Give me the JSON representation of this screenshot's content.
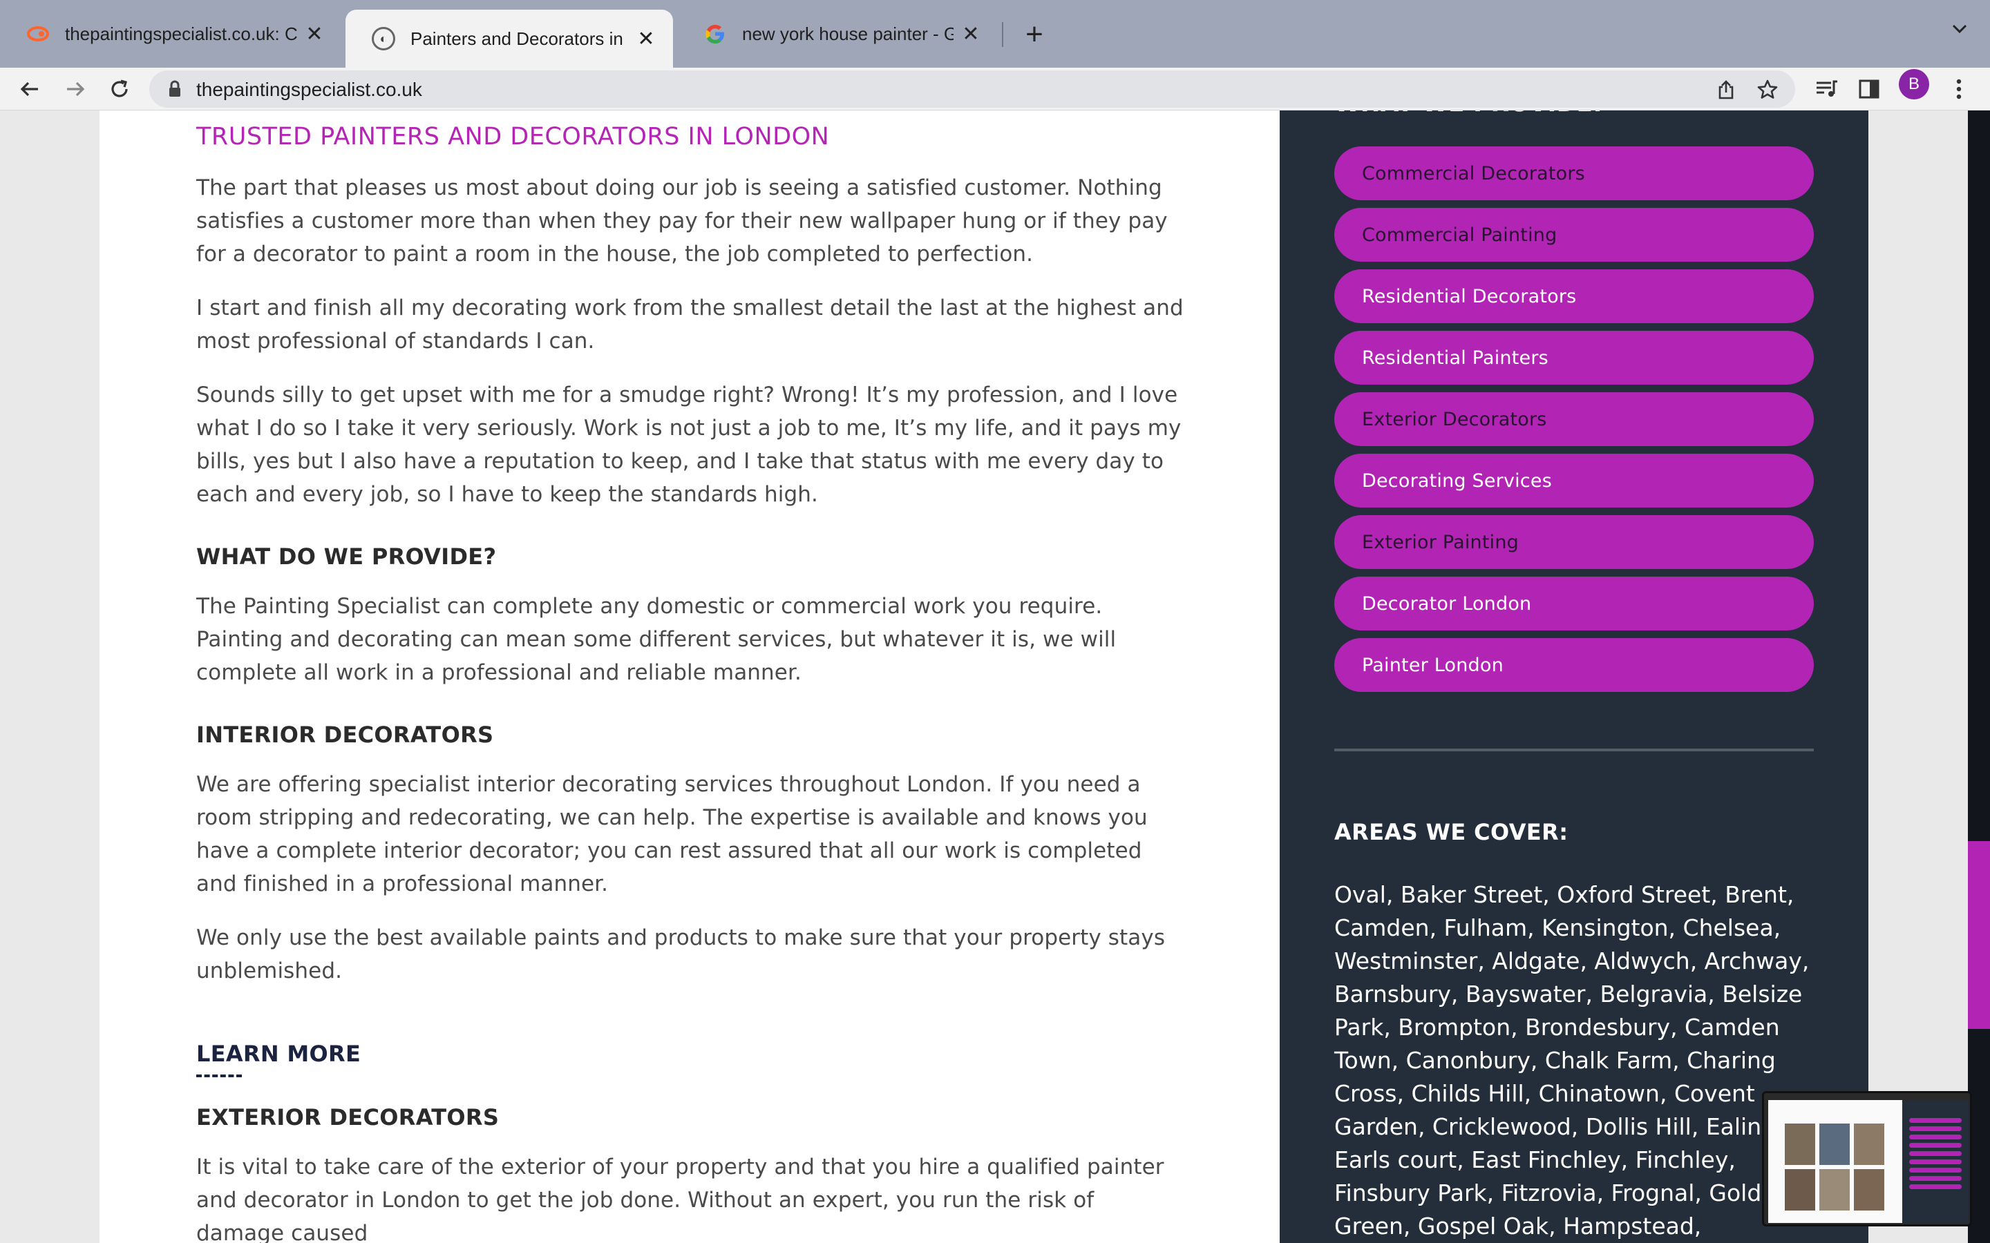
{
  "browser": {
    "tabs": [
      {
        "title": "thepaintingspecialist.co.uk: Co",
        "favicon": "semrush-icon",
        "active": false
      },
      {
        "title": "Painters and Decorators in Lon",
        "favicon": "site-icon",
        "active": true
      },
      {
        "title": "new york house painter - Goog",
        "favicon": "google-icon",
        "active": false
      }
    ],
    "new_tab_label": "+",
    "url": "thepaintingspecialist.co.uk",
    "profile_initial": "B"
  },
  "article": {
    "heading": "TRUSTED PAINTERS AND DECORATORS IN LONDON",
    "para1": "The part that pleases us most about doing our job is seeing a satisfied customer. Nothing satisfies a customer more than when they pay for their new wallpaper hung or if they pay for a decorator to paint a room in the house, the job completed to perfection.",
    "para2": "I start and finish all my decorating work from the smallest detail the last at the highest and most professional of standards I can.",
    "para3": "Sounds silly to get upset with me for a smudge right? Wrong! It’s my profession, and I love what I do so I take it very seriously. Work is not just a job to me, It’s my life, and it pays my bills, yes but I also have a reputation to keep, and I take that status with me every day to each and every job, so I have to keep the standards high.",
    "provide_heading": "WHAT DO WE PROVIDE?",
    "provide_para": "The Painting Specialist can complete any domestic or commercial work you require. Painting and decorating can mean some different services, but whatever it is, we will complete all work in a professional and reliable manner.",
    "interior_heading": "INTERIOR DECORATORS",
    "interior_para1": "We are offering specialist interior decorating services throughout London. If you need a room stripping and redecorating, we can help. The expertise is available and knows you have a complete interior decorator; you can rest assured that all our work is completed and finished in a professional manner.",
    "interior_para2": "We only use the best available paints and products to make sure that your property stays unblemished.",
    "learn_more": "LEARN MORE",
    "exterior_heading": "EXTERIOR DECORATORS",
    "exterior_para": "It is vital to take care of the exterior of your property and that you hire a qualified painter and decorator in London to get the job done. Without an expert, you run the risk of damage caused"
  },
  "sidebar": {
    "top_heading": "WHAT WE PROVIDE:",
    "services": [
      "Commercial Decorators",
      "Commercial Painting",
      "Residential Decorators",
      "Residential Painters",
      "Exterior Decorators",
      "Decorating Services",
      "Exterior Painting",
      "Decorator London",
      "Painter London"
    ],
    "areas_heading": "AREAS WE COVER:",
    "areas_text": "Oval, Baker Street, Oxford Street, Brent, Camden, Fulham, Kensington, Chelsea, Westminster, Aldgate, Aldwych, Archway, Barnsbury, Bayswater, Belgravia, Belsize Park, Brompton, Brondesbury, Camden Town, Canonbury, Chalk Farm, Charing Cross, Childs Hill, Chinatown, Covent Garden, Cricklewood, Dollis Hill, Ealing, Earls court, East Finchley, Finchley, Finsbury Park, Fitzrovia, Frognal, Golders Green, Gospel Oak, Hampstead,"
  },
  "colors": {
    "accent": "#b124b4",
    "sidebar_bg": "#232e3a",
    "heading_purple": "#b525b5"
  }
}
